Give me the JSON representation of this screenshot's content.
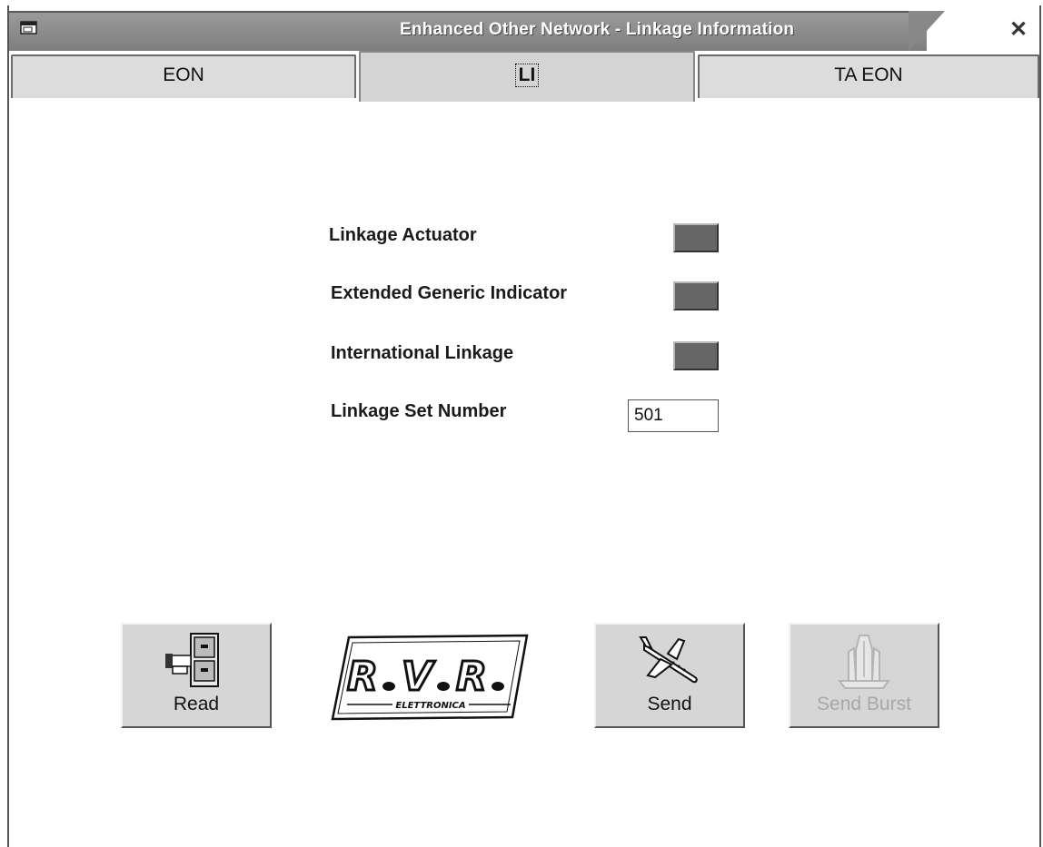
{
  "window": {
    "title": "Enhanced Other Network - Linkage Information",
    "close_glyph": "✕"
  },
  "tabs": [
    {
      "label": "EON",
      "active": false
    },
    {
      "label": "LI",
      "active": true
    },
    {
      "label": "TA EON",
      "active": false
    }
  ],
  "fields": {
    "linkage_actuator_label": "Linkage Actuator",
    "extended_generic_label": "Extended Generic Indicator",
    "international_linkage_label": "International Linkage",
    "linkage_set_number_label": "Linkage Set Number",
    "linkage_set_number_value": "501"
  },
  "buttons": {
    "read": "Read",
    "send": "Send",
    "send_burst": "Send Burst"
  },
  "logo": {
    "text": "R.V.R.",
    "subtitle": "ELETTRONICA"
  },
  "icons": {
    "app": "window-icon",
    "read": "file-cabinet-icon",
    "send": "airplane-icon",
    "send_burst": "space-shuttle-icon"
  },
  "colors": {
    "titlebar": "#8a8a8a",
    "led_off": "#666666",
    "button_face": "#d6d6d6",
    "disabled_text": "#a8a8a8"
  }
}
